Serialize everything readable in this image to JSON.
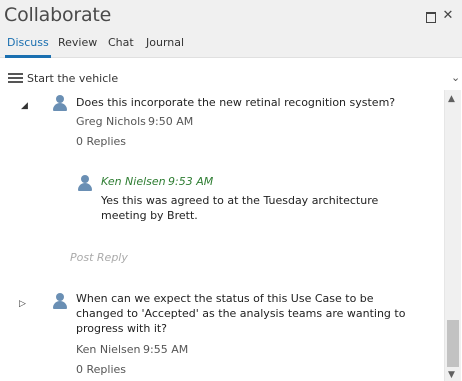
{
  "window": {
    "title": "Collaborate",
    "maximize_icon": "maximize-icon",
    "close_icon": "close-icon",
    "close_glyph": "✕"
  },
  "tabs": [
    {
      "label": "Discuss",
      "active": true
    },
    {
      "label": "Review",
      "active": false
    },
    {
      "label": "Chat",
      "active": false
    },
    {
      "label": "Journal",
      "active": false
    }
  ],
  "accent_color": "#1a6fb0",
  "toolbar": {
    "menu_icon": "hamburger-menu-icon",
    "label": "Start the vehicle",
    "chevron_glyph": "⌄"
  },
  "posts": [
    {
      "expanded": true,
      "expander_glyph": "◢",
      "text_lines": [
        "Does this incorporate the new retinal recognition system?"
      ],
      "author": "Greg Nichols",
      "time": "9:50 AM",
      "replies": "0 Replies",
      "reply": {
        "author": "Ken Nielsen",
        "time": "9:53 AM",
        "text_lines": [
          "Yes this was agreed to at the Tuesday architecture",
          "meeting by Brett."
        ]
      },
      "post_reply": "Post Reply"
    },
    {
      "expanded": false,
      "expander_glyph": "▷",
      "text_lines": [
        "When can we expect the status of this Use Case to be",
        "changed to 'Accepted' as the analysis teams are wanting to",
        "progress with it?"
      ],
      "author": "Ken Nielsen",
      "time": "9:55 AM",
      "replies": "0 Replies"
    }
  ],
  "reply_author_color": "#2e7d32",
  "scrollbar": {
    "up_glyph": "▲",
    "down_glyph": "▼",
    "scroll_position": 0.96
  }
}
